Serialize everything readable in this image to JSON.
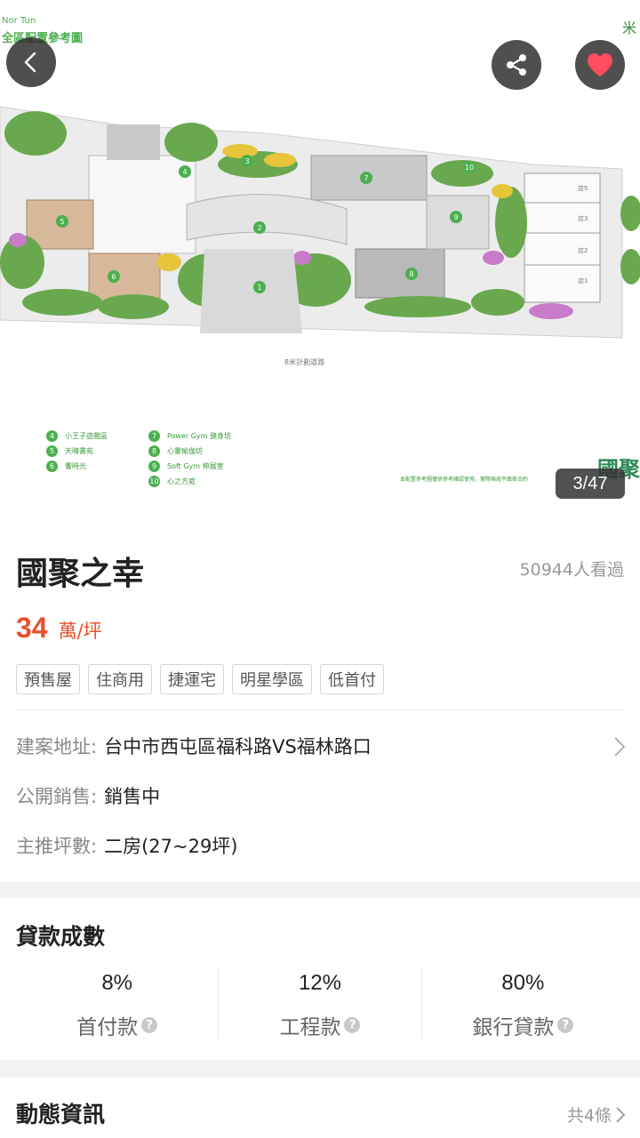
{
  "hero": {
    "small_title": "Nor Tun",
    "title": "全區配置參考圖",
    "road_label": "8米計劃道路",
    "brand_top": "米",
    "brand": "國聚",
    "note": "本配置參考圖僅供參考確認使用，實際格局平面依合約",
    "legend": [
      {
        "num": "4",
        "text": "小王子遊戲區"
      },
      {
        "num": "5",
        "text": "天晴書苑"
      },
      {
        "num": "6",
        "text": "饗時光"
      },
      {
        "num": "7",
        "text": "Power Gym 健身坊"
      },
      {
        "num": "8",
        "text": "心靈瑜伽坊"
      },
      {
        "num": "9",
        "text": "Soft Gym 伸展室"
      },
      {
        "num": "10",
        "text": "心之方庭"
      }
    ],
    "map_numbers": [
      "1",
      "2",
      "3",
      "4",
      "5",
      "6",
      "7",
      "8",
      "9",
      "10"
    ],
    "shop_labels": [
      "店5",
      "店3",
      "店2",
      "店1"
    ],
    "counter": "3/47"
  },
  "buttons": {
    "back_icon": "chevron-left-icon",
    "share_icon": "share-icon",
    "favorite_icon": "heart-icon"
  },
  "project": {
    "name": "國聚之幸",
    "views": "50944人看過",
    "price_value": "34",
    "price_unit": "萬/坪",
    "tags": [
      "預售屋",
      "住商用",
      "捷運宅",
      "明星學區",
      "低首付"
    ],
    "address_label": "建案地址:",
    "address_value": "台中市西屯區福科路VS福林路口",
    "sale_label": "公開銷售:",
    "sale_value": "銷售中",
    "size_label": "主推坪數:",
    "size_value": "二房(27~29坪)"
  },
  "loan": {
    "title": "貸款成數",
    "items": [
      {
        "pct": "8%",
        "label": "首付款"
      },
      {
        "pct": "12%",
        "label": "工程款"
      },
      {
        "pct": "80%",
        "label": "銀行貸款"
      }
    ]
  },
  "news": {
    "title": "動態資訊",
    "count": "共4條"
  },
  "colors": {
    "accent_price": "#e8502e",
    "heart": "#ff4d5e",
    "legend_green": "#4caf50"
  }
}
